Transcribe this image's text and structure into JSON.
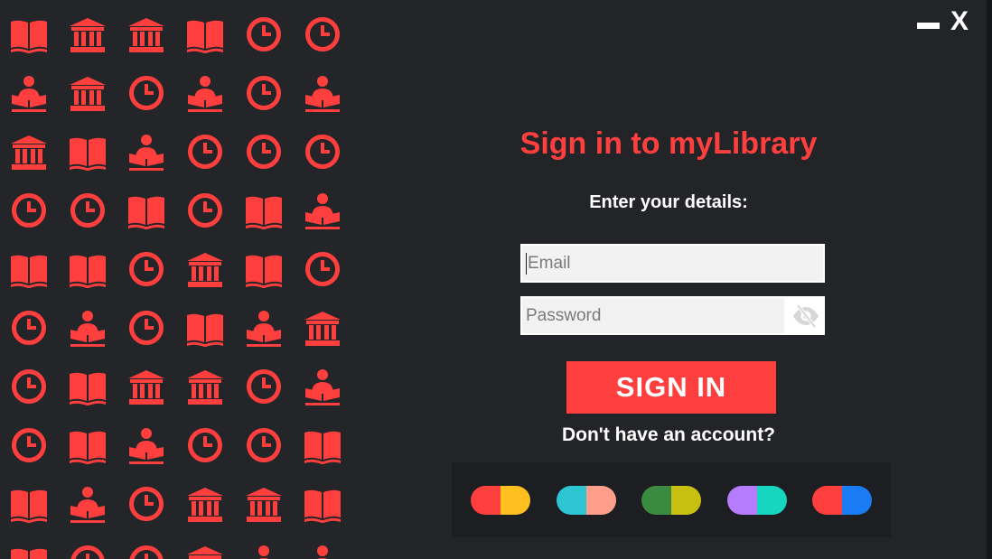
{
  "window": {
    "minimize_label": "minimize",
    "close_label": "X"
  },
  "pattern": {
    "color": "#ff3e3e",
    "rows": [
      [
        "book-icon",
        "library-icon",
        "library-icon",
        "book-icon",
        "clock-icon",
        "clock-icon"
      ],
      [
        "reader-icon",
        "library-icon",
        "clock-icon",
        "reader-icon",
        "clock-icon",
        "reader-icon"
      ],
      [
        "library-icon",
        "book-icon",
        "reader-icon",
        "clock-icon",
        "clock-icon",
        "clock-icon"
      ],
      [
        "clock-icon",
        "clock-icon",
        "book-icon",
        "clock-icon",
        "book-icon",
        "reader-icon"
      ],
      [
        "book-icon",
        "book-icon",
        "clock-icon",
        "library-icon",
        "book-icon",
        "clock-icon"
      ],
      [
        "clock-icon",
        "reader-icon",
        "clock-icon",
        "book-icon",
        "reader-icon",
        "library-icon"
      ],
      [
        "clock-icon",
        "book-icon",
        "library-icon",
        "library-icon",
        "clock-icon",
        "reader-icon"
      ],
      [
        "clock-icon",
        "book-icon",
        "reader-icon",
        "clock-icon",
        "clock-icon",
        "book-icon"
      ],
      [
        "book-icon",
        "reader-icon",
        "clock-icon",
        "library-icon",
        "library-icon",
        "book-icon"
      ],
      [
        "book-icon",
        "clock-icon",
        "clock-icon",
        "library-icon",
        "reader-icon",
        "reader-icon"
      ]
    ]
  },
  "form": {
    "title": "Sign in to myLibrary",
    "subtitle": "Enter your details:",
    "email_placeholder": "Email",
    "password_placeholder": "Password",
    "toggle_visibility_icon": "eye-slash-icon",
    "signin_label": "SIGN IN",
    "no_account_text": "Don't have an account?"
  },
  "themes": [
    {
      "left": "#ff3e3e",
      "right": "#ffbf1f"
    },
    {
      "left": "#2ec5d3",
      "right": "#ff9f8b"
    },
    {
      "left": "#3a8a3f",
      "right": "#c7c011"
    },
    {
      "left": "#b57cff",
      "right": "#16d6c0"
    },
    {
      "left": "#ff3e3e",
      "right": "#1a7cf5"
    }
  ]
}
